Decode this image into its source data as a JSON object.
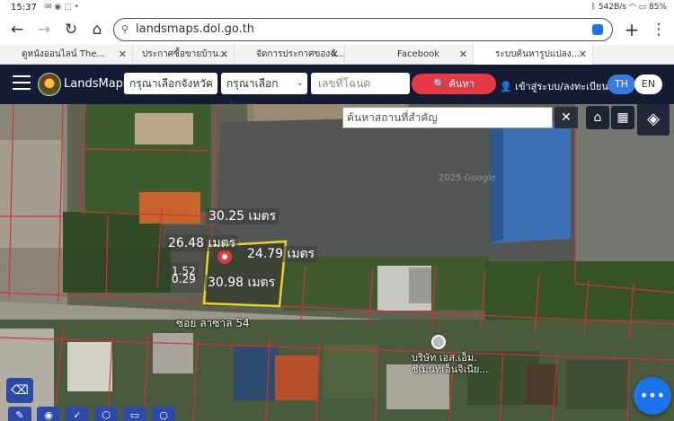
{
  "status_bar": {
    "time": "15:37",
    "speed": "542B/s",
    "battery": "85%"
  },
  "browser": {
    "url": "landsmaps.dol.go.th",
    "tabs": [
      {
        "label": "ดูหนังออนไลน์ The..."
      },
      {
        "label": "ประกาศซื้อขายบ้าน..."
      },
      {
        "label": "จัดการประกาศของฉั..."
      },
      {
        "label": "Facebook"
      },
      {
        "label": "ระบบค้นหารูปแปลง..."
      }
    ]
  },
  "header": {
    "brand": "LandsMaps",
    "province_select": "กรุณาเลือกจังหวัด",
    "district_select": "กรุณาเลือกอำเภอ",
    "deed_placeholder": "เลขที่โฉนด",
    "search_label": "ค้นหา",
    "login_label": "เข้าสู่ระบบ/ลงทะเบียน",
    "lang_th": "TH",
    "lang_en": "EN"
  },
  "map": {
    "place_search_placeholder": "ค้นหาสถานที่สำคัญ",
    "measurements": {
      "top": "30.25 เมตร",
      "left": "26.48 เมตร",
      "right": "24.79 เมตร",
      "bottom": "30.98 เมตร",
      "inner_a": "1.52",
      "inner_b": "0.29"
    },
    "road_label": "ซอย ลาซาล 54",
    "poi_label_line1": "บริษัท เอส.เอ็ม.",
    "poi_label_line2": "ซีเมนท์เอ็นจิเนีย...",
    "watermark": "2025 Google"
  }
}
